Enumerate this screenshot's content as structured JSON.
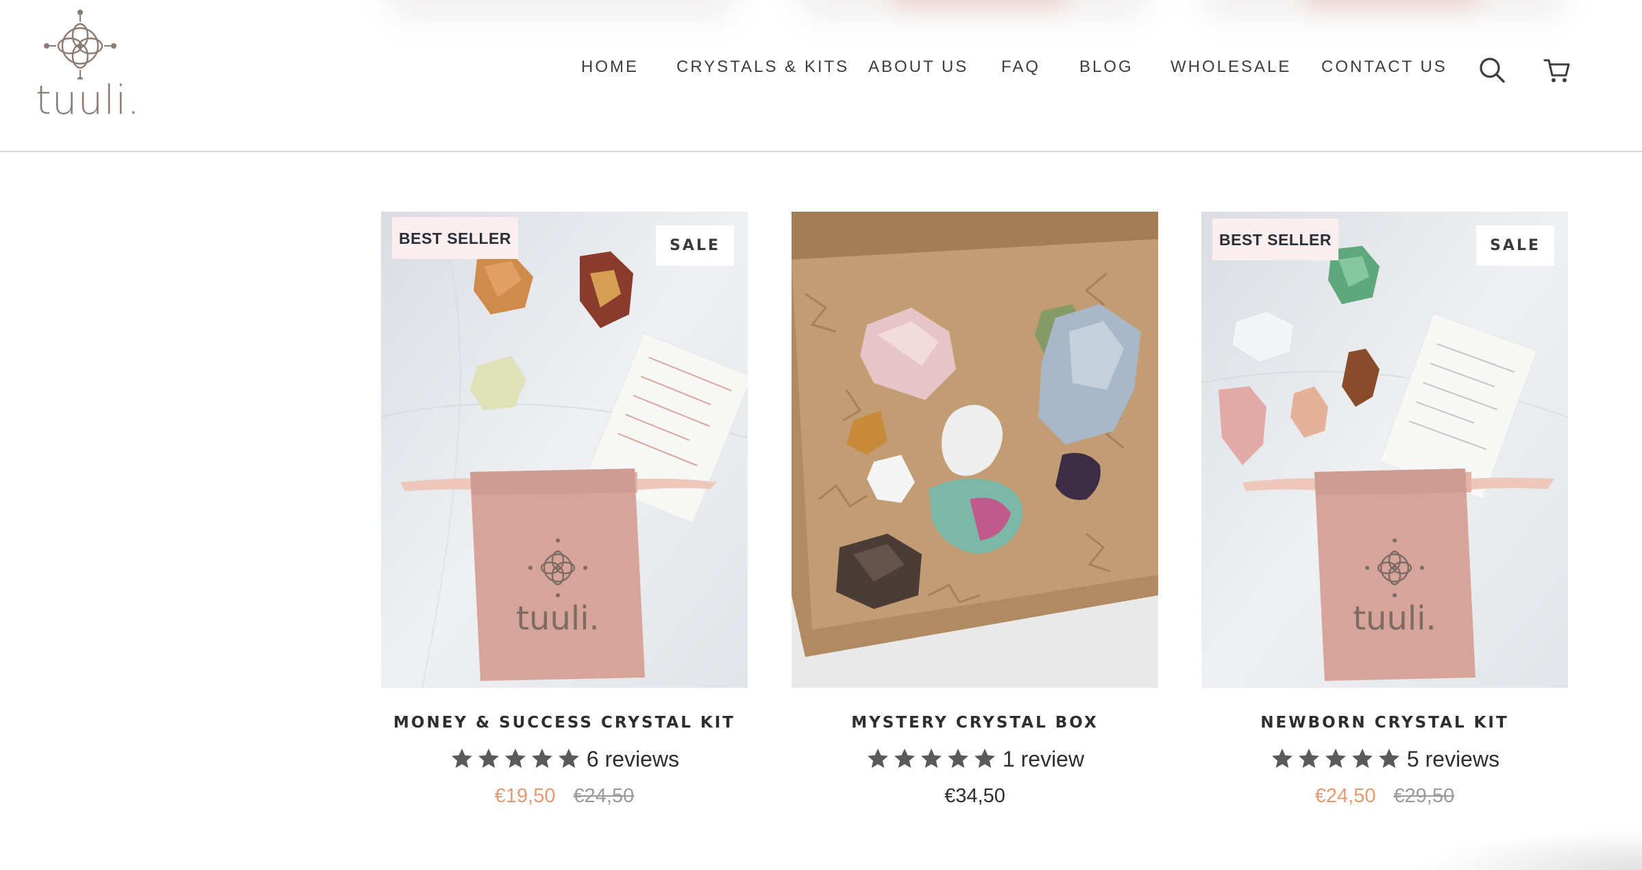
{
  "brand": {
    "logo_text": "tuuli."
  },
  "nav": {
    "items": [
      {
        "label": "HOME"
      },
      {
        "label": "CRYSTALS & KITS"
      },
      {
        "label": "ABOUT US"
      },
      {
        "label": "FAQ"
      },
      {
        "label": "BLOG"
      },
      {
        "label": "WHOLESALE"
      },
      {
        "label": "CONTACT US"
      }
    ],
    "icons": [
      "search-icon",
      "cart-icon"
    ]
  },
  "colors": {
    "accent_sale_price": "#e69a72",
    "badge_best_bg": "#fbeeee",
    "star": "#5a5a5a",
    "logo": "#8d7b71"
  },
  "products": [
    {
      "title": "MONEY & SUCCESS CRYSTAL KIT",
      "badge_left": "BEST SELLER",
      "badge_right": "SALE",
      "rating": 5,
      "reviews": "6 reviews",
      "price": "€19,50",
      "compare_price": "€24,50",
      "image_pouch_text": "tuuli."
    },
    {
      "title": "MYSTERY CRYSTAL BOX",
      "rating": 5,
      "reviews": "1 review",
      "price": "€34,50"
    },
    {
      "title": "NEWBORN CRYSTAL KIT",
      "badge_left": "BEST SELLER",
      "badge_right": "SALE",
      "rating": 5,
      "reviews": "5 reviews",
      "price": "€24,50",
      "compare_price": "€29,50",
      "image_pouch_text": "tuuli."
    }
  ]
}
